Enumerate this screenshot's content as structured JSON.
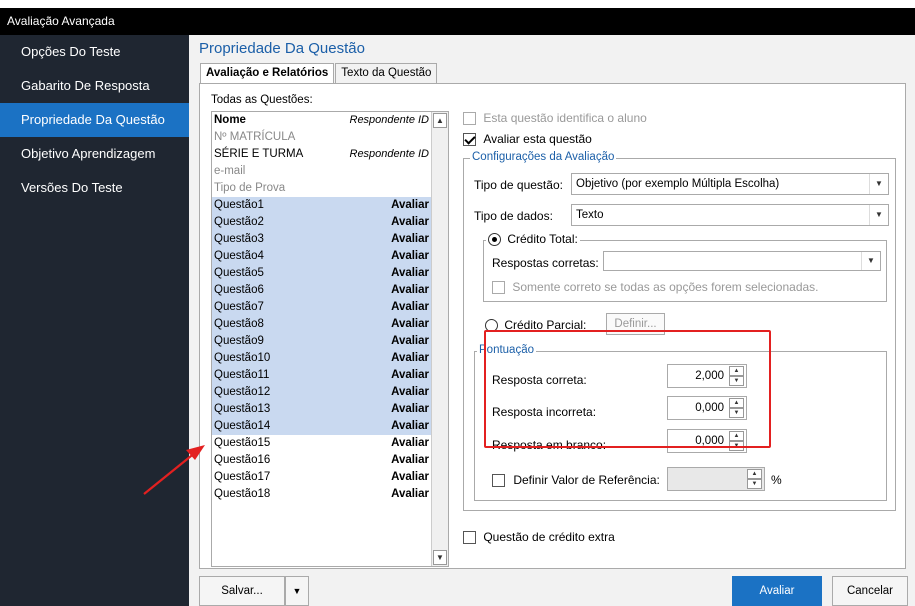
{
  "window": {
    "title": "Avaliação Avançada"
  },
  "sidebar": {
    "items": [
      {
        "label": "Opções Do Teste"
      },
      {
        "label": "Gabarito De Resposta"
      },
      {
        "label": "Propriedade Da Questão"
      },
      {
        "label": "Objetivo Aprendizagem"
      },
      {
        "label": "Versões Do Teste"
      }
    ]
  },
  "main": {
    "heading": "Propriedade Da Questão",
    "tabs": [
      {
        "label": "Avaliação e Relatórios"
      },
      {
        "label": "Texto da Questão"
      }
    ]
  },
  "question_list": {
    "label": "Todas as Questões:",
    "rows": [
      {
        "name": "Nome",
        "value": "Respondente ID"
      },
      {
        "name": "Nº MATRÍCULA",
        "value": ""
      },
      {
        "name": "SÉRIE E TURMA",
        "value": "Respondente ID"
      },
      {
        "name": "e-mail",
        "value": ""
      },
      {
        "name": "Tipo de Prova",
        "value": ""
      },
      {
        "name": "Questão1",
        "value": "Avaliar"
      },
      {
        "name": "Questão2",
        "value": "Avaliar"
      },
      {
        "name": "Questão3",
        "value": "Avaliar"
      },
      {
        "name": "Questão4",
        "value": "Avaliar"
      },
      {
        "name": "Questão5",
        "value": "Avaliar"
      },
      {
        "name": "Questão6",
        "value": "Avaliar"
      },
      {
        "name": "Questão7",
        "value": "Avaliar"
      },
      {
        "name": "Questão8",
        "value": "Avaliar"
      },
      {
        "name": "Questão9",
        "value": "Avaliar"
      },
      {
        "name": "Questão10",
        "value": "Avaliar"
      },
      {
        "name": "Questão11",
        "value": "Avaliar"
      },
      {
        "name": "Questão12",
        "value": "Avaliar"
      },
      {
        "name": "Questão13",
        "value": "Avaliar"
      },
      {
        "name": "Questão14",
        "value": "Avaliar"
      },
      {
        "name": "Questão15",
        "value": "Avaliar"
      },
      {
        "name": "Questão16",
        "value": "Avaliar"
      },
      {
        "name": "Questão17",
        "value": "Avaliar"
      },
      {
        "name": "Questão18",
        "value": "Avaliar"
      }
    ]
  },
  "props": {
    "identifies_student": "Esta questão identifica o aluno",
    "evaluate_question": "Avaliar esta questão",
    "config_legend": "Configurações da Avaliação",
    "question_type_label": "Tipo de questão:",
    "question_type_value": "Objetivo (por exemplo Múltipla Escolha)",
    "data_type_label": "Tipo de dados:",
    "data_type_value": "Texto",
    "full_credit": "Crédito Total:",
    "correct_answers_label": "Respostas corretas:",
    "correct_answers_value": "",
    "only_correct_all": "Somente correto se todas as opções forem selecionadas.",
    "partial_credit": "Crédito Parcial:",
    "define_button": "Definir...",
    "scoring_legend": "Pontuação",
    "correct_label": "Resposta correta:",
    "correct_value": "2,000",
    "incorrect_label": "Resposta incorreta:",
    "incorrect_value": "0,000",
    "blank_label": "Resposta em branco:",
    "blank_value": "0,000",
    "reference_label": "Definir Valor de Referência:",
    "reference_value": "",
    "percent": "%",
    "extra_credit": "Questão de crédito extra"
  },
  "footer": {
    "save_label": "Salvar...",
    "evaluate_label": "Avaliar",
    "cancel_label": "Cancelar"
  },
  "colors": {
    "sidebar_bg": "#1f2631",
    "sidebar_active": "#1b72c4",
    "selection": "#c9d9f0",
    "highlight_box": "#e32020",
    "primary_button": "#1b72c4"
  }
}
